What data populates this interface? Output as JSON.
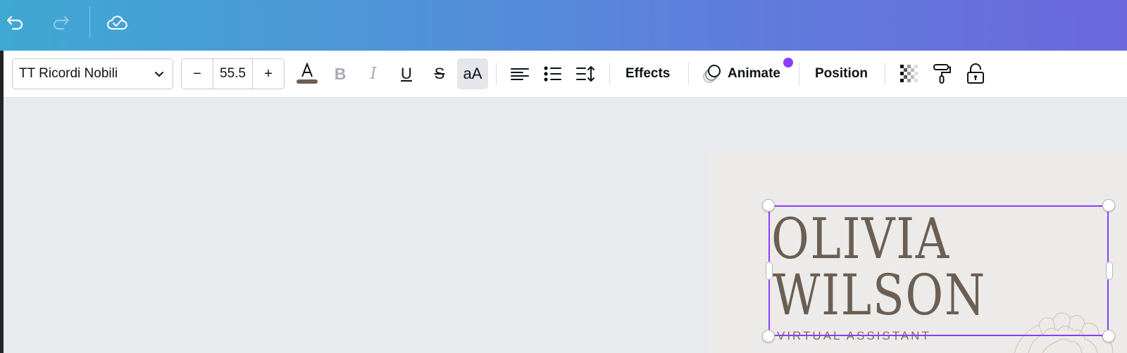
{
  "header": {
    "undo_icon": "undo-icon",
    "redo_icon": "redo-icon",
    "save_status_icon": "cloud-check-icon"
  },
  "toolbar": {
    "font_family": "TT Ricordi Nobili",
    "font_size": "55.5",
    "decrease_label": "−",
    "increase_label": "+",
    "text_color": "#6b5e53",
    "bold_label": "B",
    "italic_label": "I",
    "underline_label": "U",
    "strike_label": "S",
    "case_label": "aA",
    "effects_label": "Effects",
    "animate_label": "Animate",
    "position_label": "Position",
    "accent_color": "#8b3dff"
  },
  "canvas": {
    "name_line_1": "OLIVIA",
    "name_line_2": "WILSON",
    "subtitle": "VIRTUAL ASSISTANT"
  }
}
